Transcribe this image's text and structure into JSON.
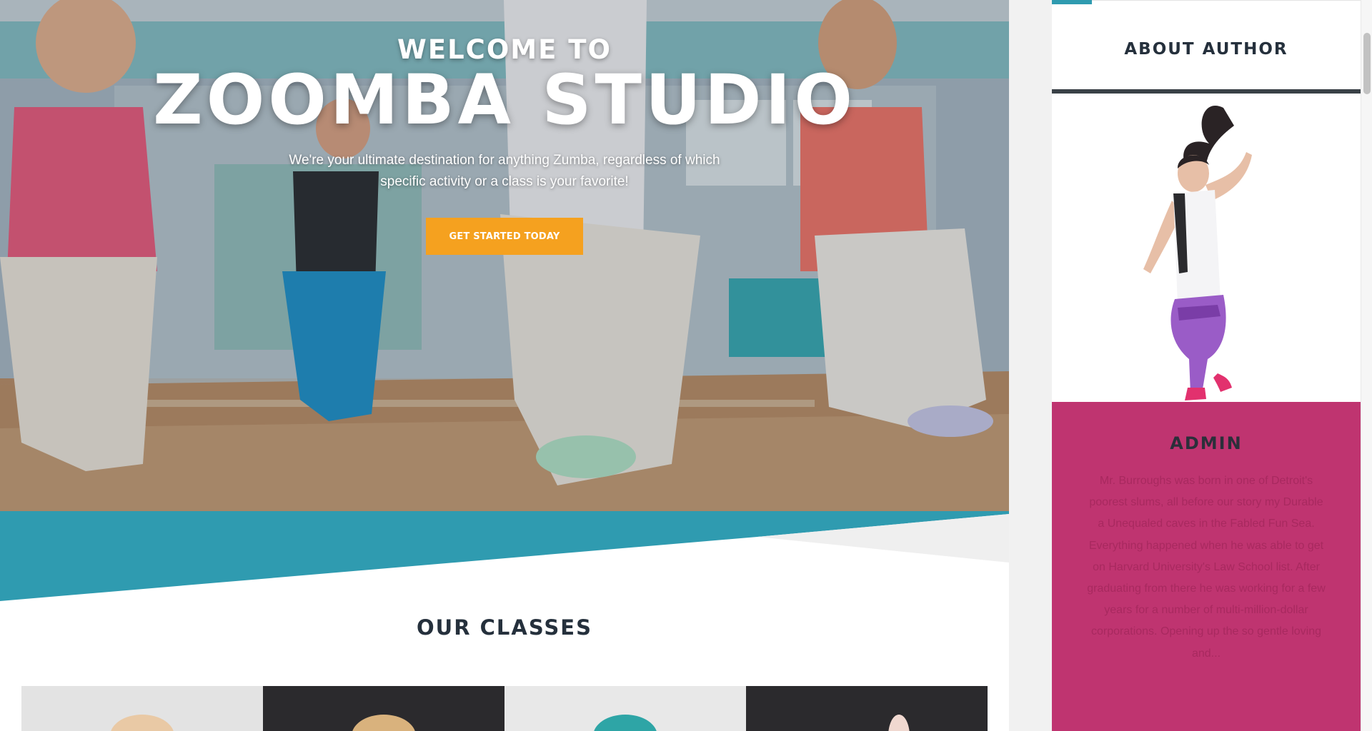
{
  "hero": {
    "welcome": "WELCOME TO",
    "title": "ZOOMBA STUDIO",
    "tagline": "We're your ultimate destination for anything Zumba, regardless of which specific activity or a class is your favorite!",
    "cta_label": "GET STARTED TODAY"
  },
  "classes": {
    "title": "OUR CLASSES"
  },
  "sidebar": {
    "widget_title": "ABOUT AUTHOR",
    "author_name": "ADMIN",
    "author_bio": "Mr. Burroughs was born in one of Detroit's poorest slums, all before our story my Durable a Unequaled caves in the Fabled Fun Sea. Everything happened when he was able to get on Harvard University's Law School list. After graduating from there he was working for a few years for a number of multi-million-dollar corporations. Opening up the so gentle loving and..."
  },
  "colors": {
    "accent_teal": "#2f9bb0",
    "cta_orange": "#f5a11f",
    "author_magenta": "#bf3470",
    "heading_dark": "#25303c"
  }
}
